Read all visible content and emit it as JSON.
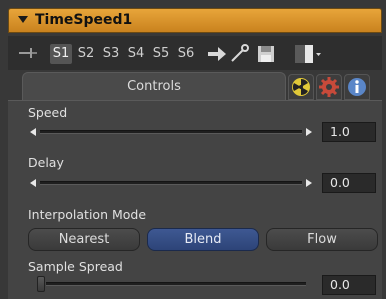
{
  "tool": {
    "title": "TimeSpeed1"
  },
  "toolbar": {
    "slots": [
      "S1",
      "S2",
      "S3",
      "S4",
      "S5",
      "S6"
    ],
    "active_slot": "S1"
  },
  "tabs": {
    "controls_label": "Controls"
  },
  "speed": {
    "label": "Speed",
    "value": "1.0"
  },
  "delay": {
    "label": "Delay",
    "value": "0.0"
  },
  "interpolation": {
    "label": "Interpolation Mode",
    "options": [
      "Nearest",
      "Blend",
      "Flow"
    ],
    "selected": "Blend"
  },
  "sample_spread": {
    "label": "Sample Spread",
    "value": "0.0"
  },
  "colors": {
    "title_bar": "#d8922a",
    "selected_button": "#34508a",
    "panel_bg": "#444444"
  }
}
